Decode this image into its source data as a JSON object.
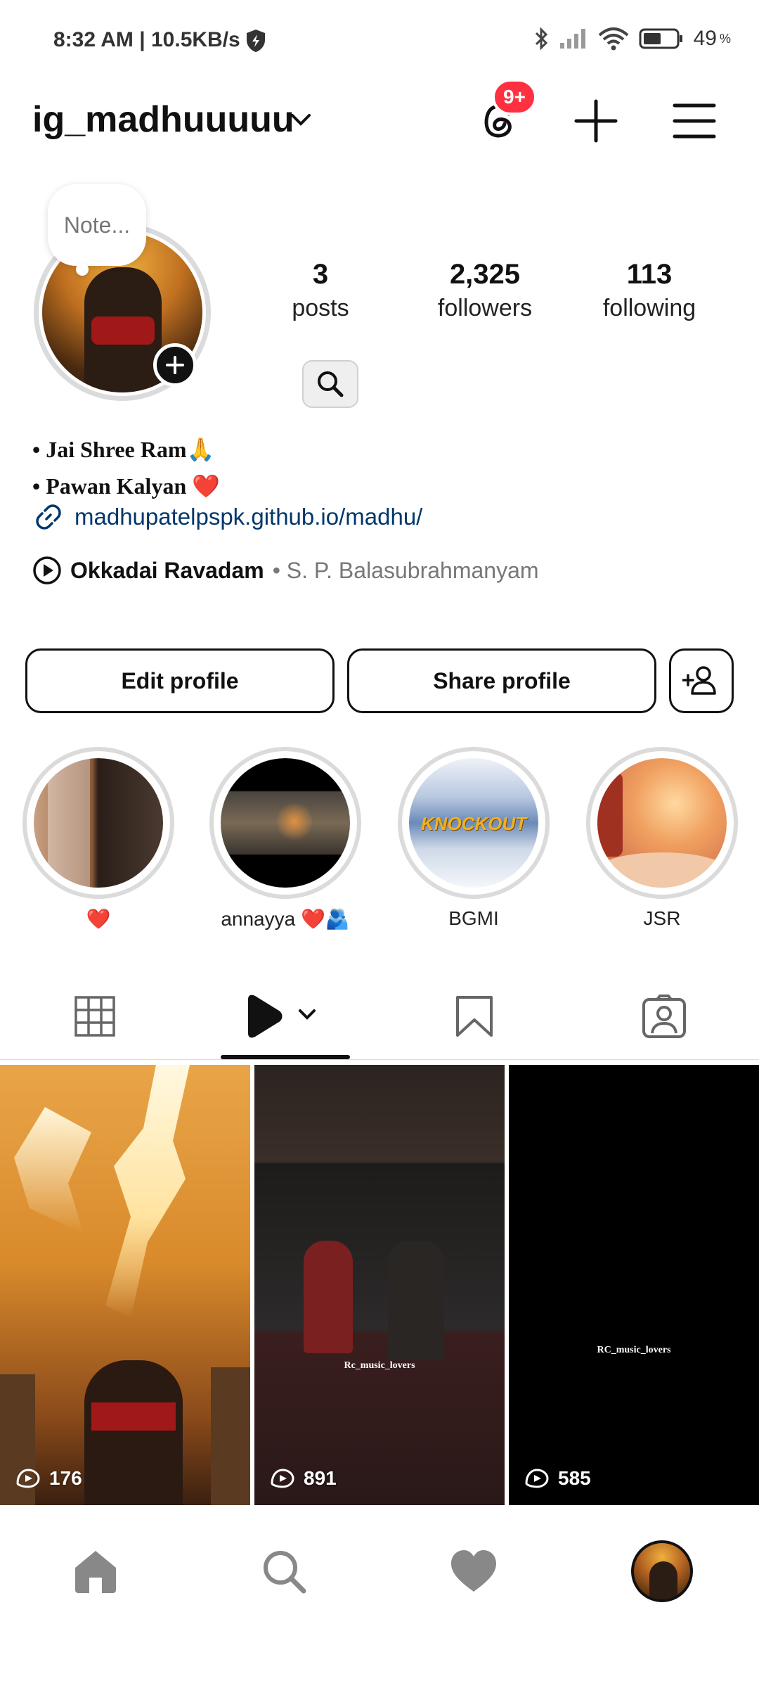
{
  "status_bar": {
    "time_speed": "8:32 AM | 10.5KB/s",
    "battery": "49"
  },
  "header": {
    "username": "ig_madhuuuuu",
    "threads_badge": "9+"
  },
  "profile": {
    "note_placeholder": "Note...",
    "stats": {
      "posts_count": "3",
      "posts_label": "posts",
      "followers_count": "2,325",
      "followers_label": "followers",
      "following_count": "113",
      "following_label": "following"
    },
    "bio": {
      "line1": "• Jai Shree Ram🙏",
      "line2": "• Pawan Kalyan ❤️",
      "link": "madhupatelpspk.github.io/madhu/"
    },
    "music": {
      "title": "Okkadai Ravadam",
      "artist": "• S. P. Balasubrahmanyam"
    }
  },
  "actions": {
    "edit_label": "Edit profile",
    "share_label": "Share profile"
  },
  "highlights": [
    {
      "label": "❤️"
    },
    {
      "label": "annayya ❤️🫂"
    },
    {
      "label": "BGMI",
      "text": "KNOCKOUT"
    },
    {
      "label": "JSR"
    }
  ],
  "tiles": [
    {
      "views": "176"
    },
    {
      "views": "891",
      "watermark": "Rc_music_lovers"
    },
    {
      "views": "585",
      "watermark": "RC_music_lovers"
    }
  ],
  "tabs": {
    "active": "reels"
  },
  "colors": {
    "badge": "#ff3040",
    "link": "#00376b"
  }
}
